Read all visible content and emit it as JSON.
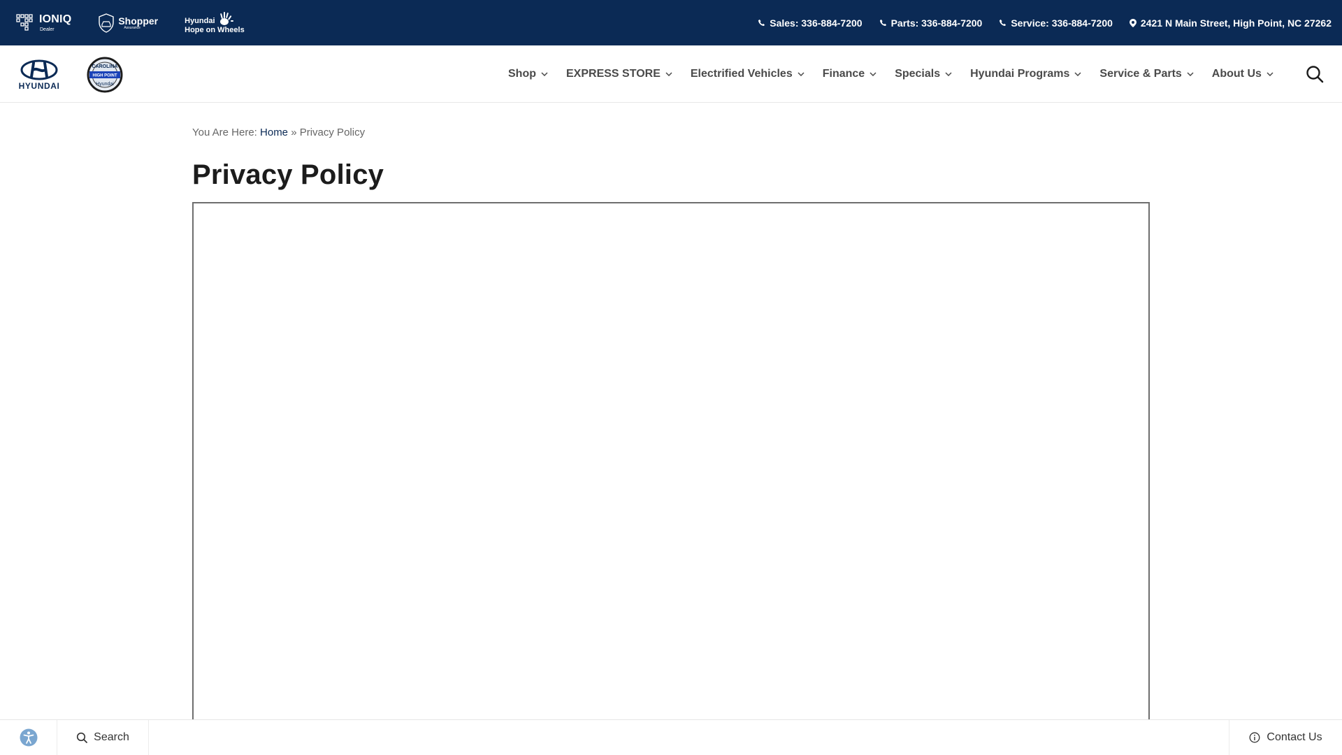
{
  "topbar": {
    "brands": {
      "ioniq": {
        "name": "IONIQ",
        "sub": "Dealer",
        "icon": "ioniq-grid-icon"
      },
      "shopper": {
        "name": "Shopper",
        "sub": "Assurance",
        "icon": "shield-car-icon"
      },
      "hope": {
        "line1": "Hyundai",
        "line2": "Hope on Wheels",
        "icon": "handprint-icon"
      }
    },
    "contacts": {
      "sales": "Sales: 336-884-7200",
      "parts": "Parts: 336-884-7200",
      "service": "Service: 336-884-7200",
      "address": "2421 N Main Street, High Point, NC 27262"
    }
  },
  "header": {
    "logo_text": "HYUNDAI",
    "badge": {
      "top": "CAROLINA",
      "mid": "HIGH POINT",
      "bottom": "Hyundai"
    },
    "nav": [
      {
        "label": "Shop"
      },
      {
        "label": "EXPRESS STORE"
      },
      {
        "label": "Electrified Vehicles"
      },
      {
        "label": "Finance"
      },
      {
        "label": "Specials"
      },
      {
        "label": "Hyundai Programs"
      },
      {
        "label": "Service & Parts"
      },
      {
        "label": "About Us"
      }
    ]
  },
  "breadcrumb": {
    "prefix": "You Are Here: ",
    "home": "Home",
    "separator": " » ",
    "current": "Privacy Policy"
  },
  "page": {
    "title": "Privacy Policy"
  },
  "bottombar": {
    "search_label": "Search",
    "contact_label": "Contact Us"
  },
  "colors": {
    "brand_navy": "#0b2a55",
    "nav_text": "#4a4a4a",
    "accessibility_blue": "#7aa6d0"
  }
}
